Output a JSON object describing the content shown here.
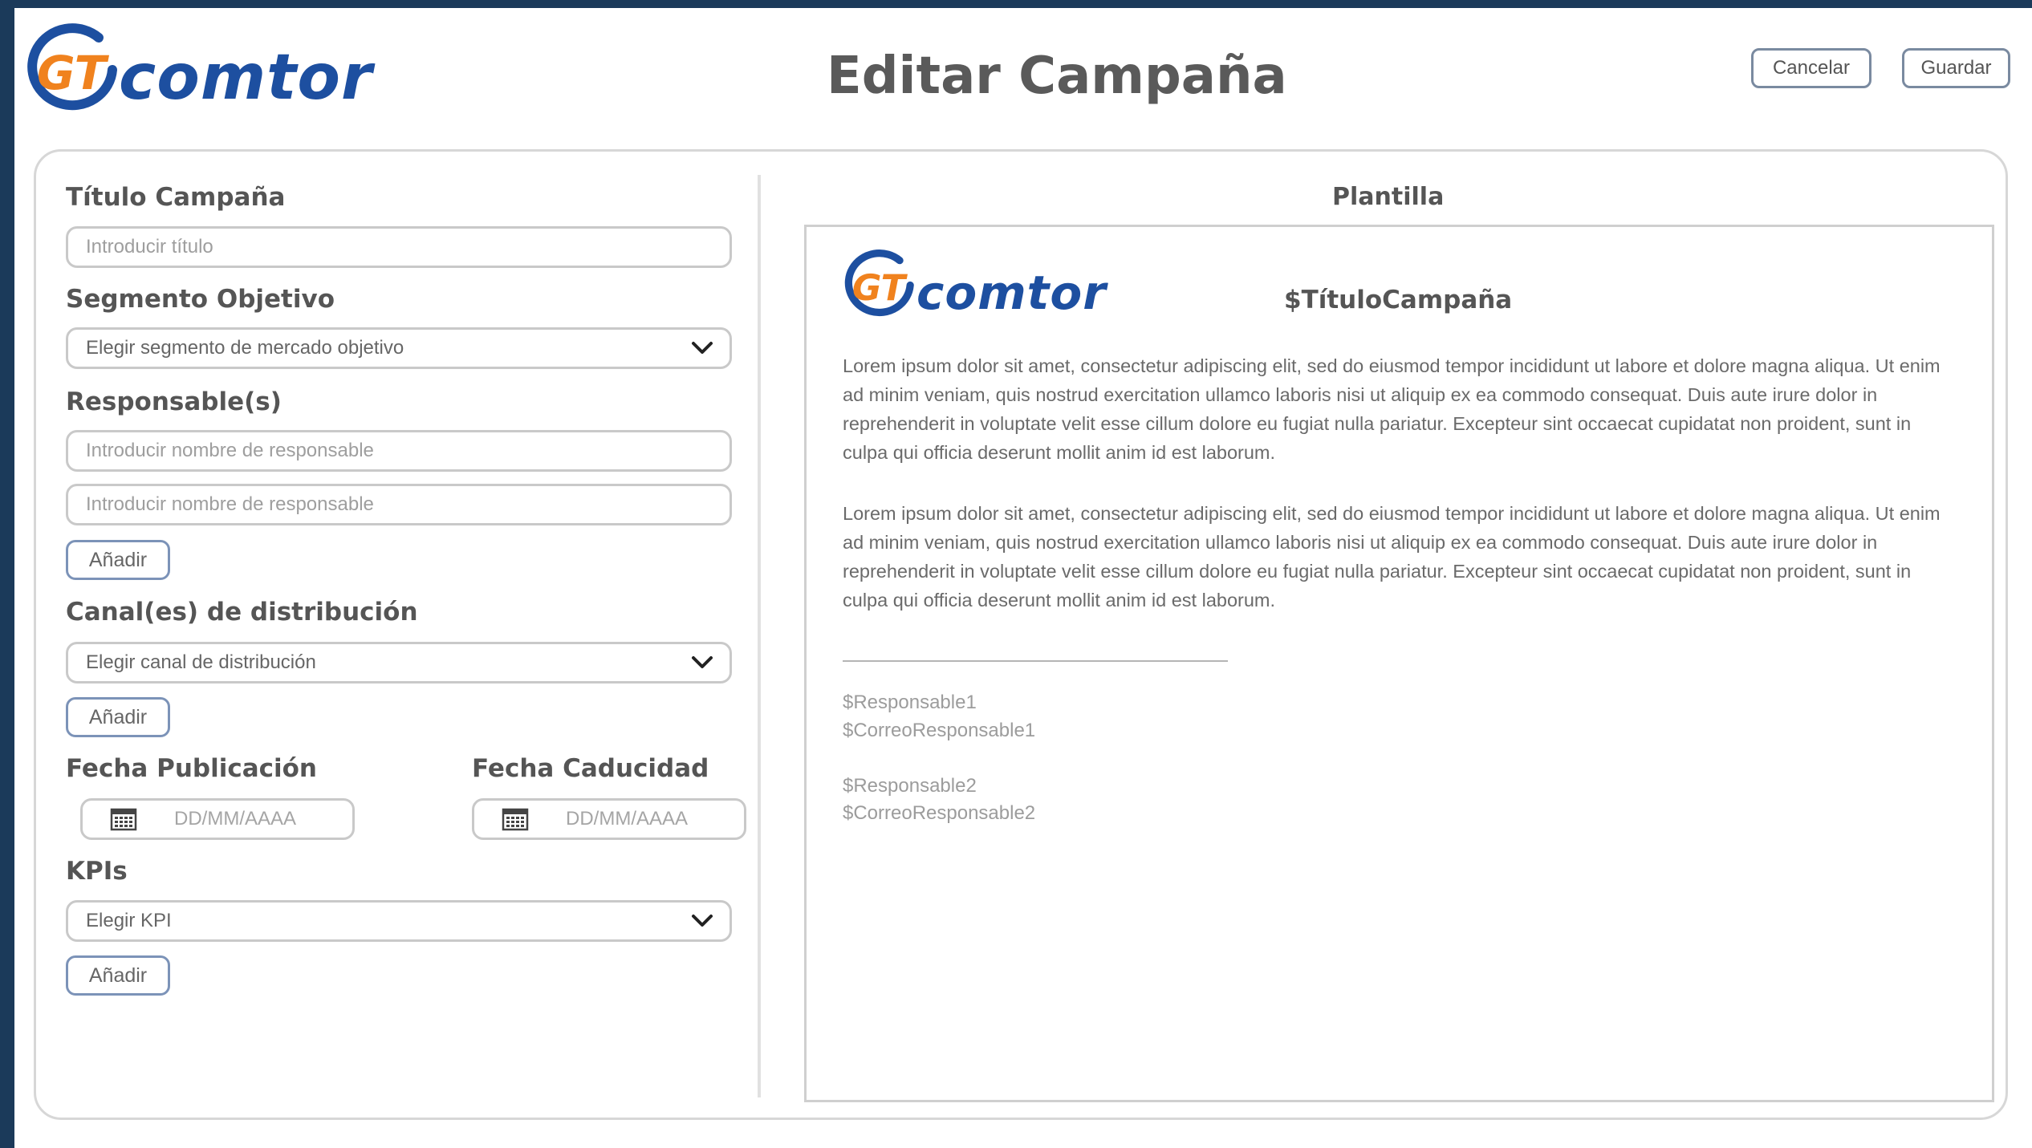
{
  "header": {
    "logo_text": "comtor",
    "title": "Editar Campaña",
    "cancel_label": "Cancelar",
    "save_label": "Guardar"
  },
  "form": {
    "title_label": "Título Campaña",
    "title_placeholder": "Introducir título",
    "segment_label": "Segmento Objetivo",
    "segment_value": "Elegir segmento de mercado objetivo",
    "responsible_label": "Responsable(s)",
    "responsible_placeholders": [
      "Introducir nombre de responsable",
      "Introducir nombre de responsable"
    ],
    "add_label": "Añadir",
    "channel_label": "Canal(es) de distribución",
    "channel_value": "Elegir canal de distribución",
    "pub_date_label": "Fecha Publicación",
    "exp_date_label": "Fecha Caducidad",
    "date_placeholder": "DD/MM/AAAA",
    "kpi_label": "KPIs",
    "kpi_value": "Elegir KPI"
  },
  "template": {
    "heading": "Plantilla",
    "logo_text": "comtor",
    "title_var": "$TítuloCampaña",
    "paragraphs": [
      "Lorem ipsum dolor sit amet, consectetur adipiscing elit, sed do eiusmod tempor incididunt ut labore et dolore magna aliqua. Ut enim ad minim veniam, quis nostrud exercitation ullamco laboris nisi ut aliquip ex ea commodo consequat. Duis aute irure dolor in reprehenderit in voluptate velit esse cillum dolore eu fugiat nulla pariatur. Excepteur sint occaecat cupidatat non proident, sunt in culpa qui officia deserunt mollit anim id est laborum.",
      "Lorem ipsum dolor sit amet, consectetur adipiscing elit, sed do eiusmod tempor incididunt ut labore et dolore magna aliqua. Ut enim ad minim veniam, quis nostrud exercitation ullamco laboris nisi ut aliquip ex ea commodo consequat. Duis aute irure dolor in reprehenderit in voluptate velit esse cillum dolore eu fugiat nulla pariatur. Excepteur sint occaecat cupidatat non proident, sunt in culpa qui officia deserunt mollit anim id est laborum."
    ],
    "responsible_1": "$Responsable1",
    "email_1": "$CorreoResponsable1",
    "responsible_2": "$Responsable2",
    "email_2": "$CorreoResponsable2"
  },
  "colors": {
    "brand_blue": "#1d4fa0",
    "brand_orange": "#f0821e",
    "frame_navy": "#1b3a5a"
  },
  "icons": [
    "comtor-logo-icon",
    "chevron-down-icon",
    "calendar-icon"
  ]
}
